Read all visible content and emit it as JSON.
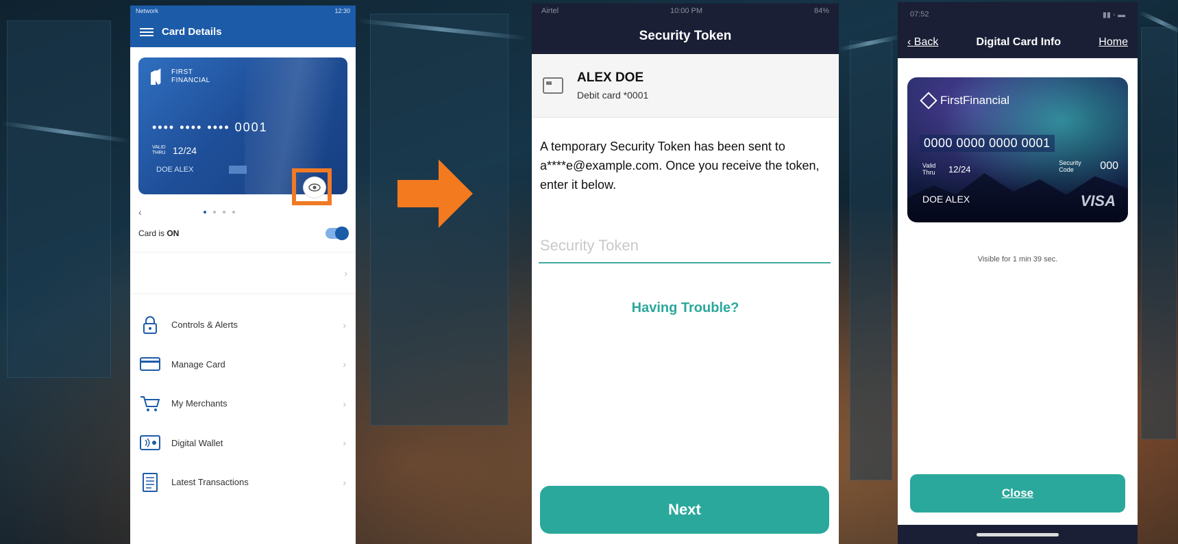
{
  "colors": {
    "primary_blue": "#1c5ba8",
    "teal": "#2aa89c",
    "dark_header": "#1a1f35",
    "highlight": "#f07a25"
  },
  "screen1": {
    "status": {
      "carrier": "Network",
      "time": "12:30"
    },
    "header_title": "Card Details",
    "card": {
      "bank_line1": "FIRST",
      "bank_line2": "FINANCIAL",
      "masked_number": "•••• •••• •••• 0001",
      "valid_label": "VALID THRU",
      "expiry": "12/24",
      "holder": "DOE ALEX"
    },
    "eye_icon": "eye-icon",
    "pager_prev": "‹",
    "card_status_prefix": "Card is ",
    "card_status_value": "ON",
    "menu": [
      {
        "label": "Controls & Alerts",
        "icon": "lock-icon"
      },
      {
        "label": "Manage Card",
        "icon": "card-icon"
      },
      {
        "label": "My Merchants",
        "icon": "cart-icon"
      },
      {
        "label": "Digital Wallet",
        "icon": "wallet-icon"
      },
      {
        "label": "Latest Transactions",
        "icon": "receipt-icon"
      }
    ]
  },
  "screen2": {
    "status": {
      "carrier": "Airtel",
      "time": "10:00 PM",
      "battery": "84%"
    },
    "header_title": "Security Token",
    "holder_name": "ALEX DOE",
    "card_desc": "Debit card *0001",
    "message": "A temporary Security Token has been sent to a****e@example.com.  Once you receive the token, enter it below.",
    "token_placeholder": "Security Token",
    "trouble_link": "Having Trouble?",
    "next_button": "Next"
  },
  "screen3": {
    "status": {
      "time": "07:52"
    },
    "back_label": "Back",
    "header_title": "Digital Card Info",
    "home_label": "Home",
    "card": {
      "brand": "FirstFinancial",
      "number": "0000 0000 0000 0001",
      "valid_label": "Valid Thru",
      "expiry": "12/24",
      "security_label": "Security Code",
      "security_code": "000",
      "holder": "DOE ALEX",
      "network": "VISA"
    },
    "visible_text": "Visible for 1 min 39 sec.",
    "close_button": "Close"
  }
}
